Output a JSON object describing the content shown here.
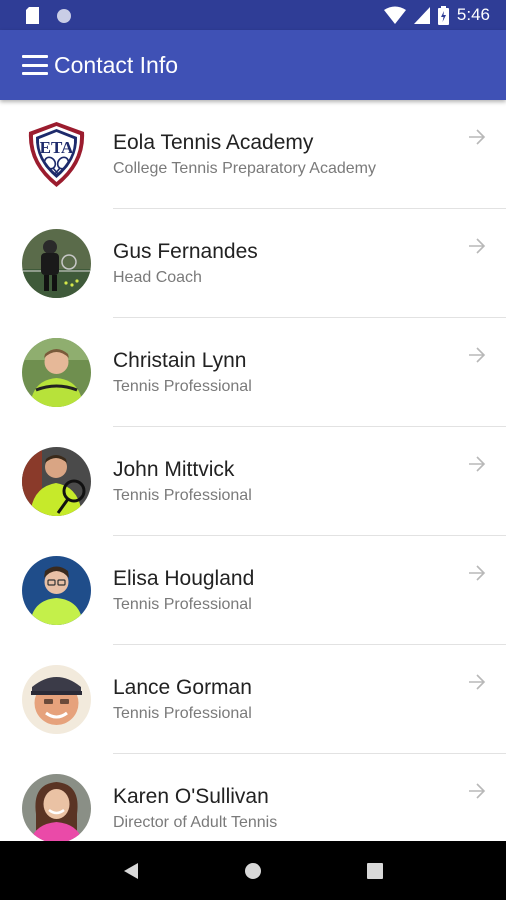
{
  "status_bar": {
    "time": "5:46",
    "icons": [
      "sd-card-icon",
      "circle-notification-icon",
      "wifi-icon",
      "cell-signal-icon",
      "battery-icon"
    ]
  },
  "app_bar": {
    "title": "Contact Info",
    "menu_icon": "menu-icon"
  },
  "logo_text": "ETA",
  "contacts": [
    {
      "name": "Eola Tennis Academy",
      "subtitle": "College Tennis Preparatory Academy"
    },
    {
      "name": "Gus Fernandes",
      "subtitle": "Head Coach"
    },
    {
      "name": "Christain Lynn",
      "subtitle": "Tennis Professional"
    },
    {
      "name": "John Mittvick",
      "subtitle": "Tennis Professional"
    },
    {
      "name": "Elisa Hougland",
      "subtitle": "Tennis Professional"
    },
    {
      "name": "Lance Gorman",
      "subtitle": "Tennis Professional"
    },
    {
      "name": "Karen O'Sullivan",
      "subtitle": "Director of Adult Tennis"
    }
  ],
  "nav_bar": {
    "icons": [
      "back-icon",
      "home-icon",
      "recents-icon"
    ]
  },
  "colors": {
    "status_bar": "#2f3d96",
    "app_bar": "#3f51b5",
    "primary_text": "#222222",
    "secondary_text": "#7a7a7a",
    "arrow": "#b8b8b8"
  }
}
